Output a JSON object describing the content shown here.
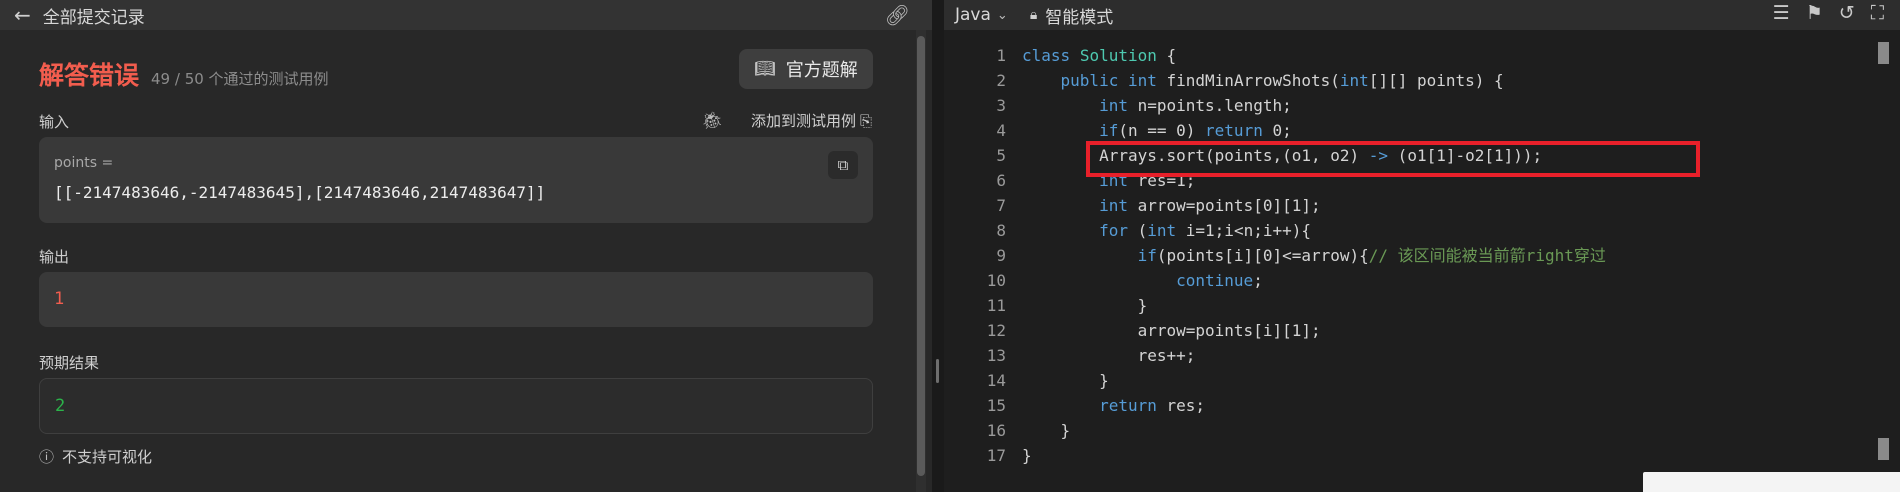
{
  "left": {
    "header": {
      "back_icon": "arrow-left-icon",
      "title": "全部提交记录",
      "link_icon": "link-icon"
    },
    "result": {
      "status": "解答错误",
      "pass_text": "49 / 50 个通过的测试用例",
      "solution_button": "官方题解"
    },
    "input": {
      "label": "输入",
      "add_testcase": "添加到测试用例",
      "param_name": "points =",
      "param_value": "[[-2147483646,-2147483645],[2147483646,2147483647]]"
    },
    "output": {
      "label": "输出",
      "value": "1"
    },
    "expected": {
      "label": "预期结果",
      "value": "2"
    },
    "visualization": {
      "text": "不支持可视化"
    },
    "colors": {
      "error": "#f25d4e",
      "success": "#2bb34a"
    }
  },
  "right": {
    "header": {
      "language": "Java",
      "mode": "智能模式"
    },
    "line_numbers": [
      "1",
      "2",
      "3",
      "4",
      "5",
      "6",
      "7",
      "8",
      "9",
      "10",
      "11",
      "12",
      "13",
      "14",
      "15",
      "16",
      "17"
    ],
    "code_lines": [
      "class Solution {",
      "    public int findMinArrowShots(int[][] points) {",
      "        int n=points.length;",
      "        if(n == 0) return 0;",
      "        Arrays.sort(points,(o1, o2) -> (o1[1]-o2[1]));",
      "        int res=1;",
      "        int arrow=points[0][1];",
      "        for (int i=1;i<n;i++){",
      "            if(points[i][0]<=arrow){// 该区间能被当前箭right穿过",
      "                continue;",
      "            }",
      "            arrow=points[i][1];",
      "            res++;",
      "        }",
      "        return res;",
      "    }",
      "}"
    ],
    "highlight_color": "#e8202a"
  }
}
